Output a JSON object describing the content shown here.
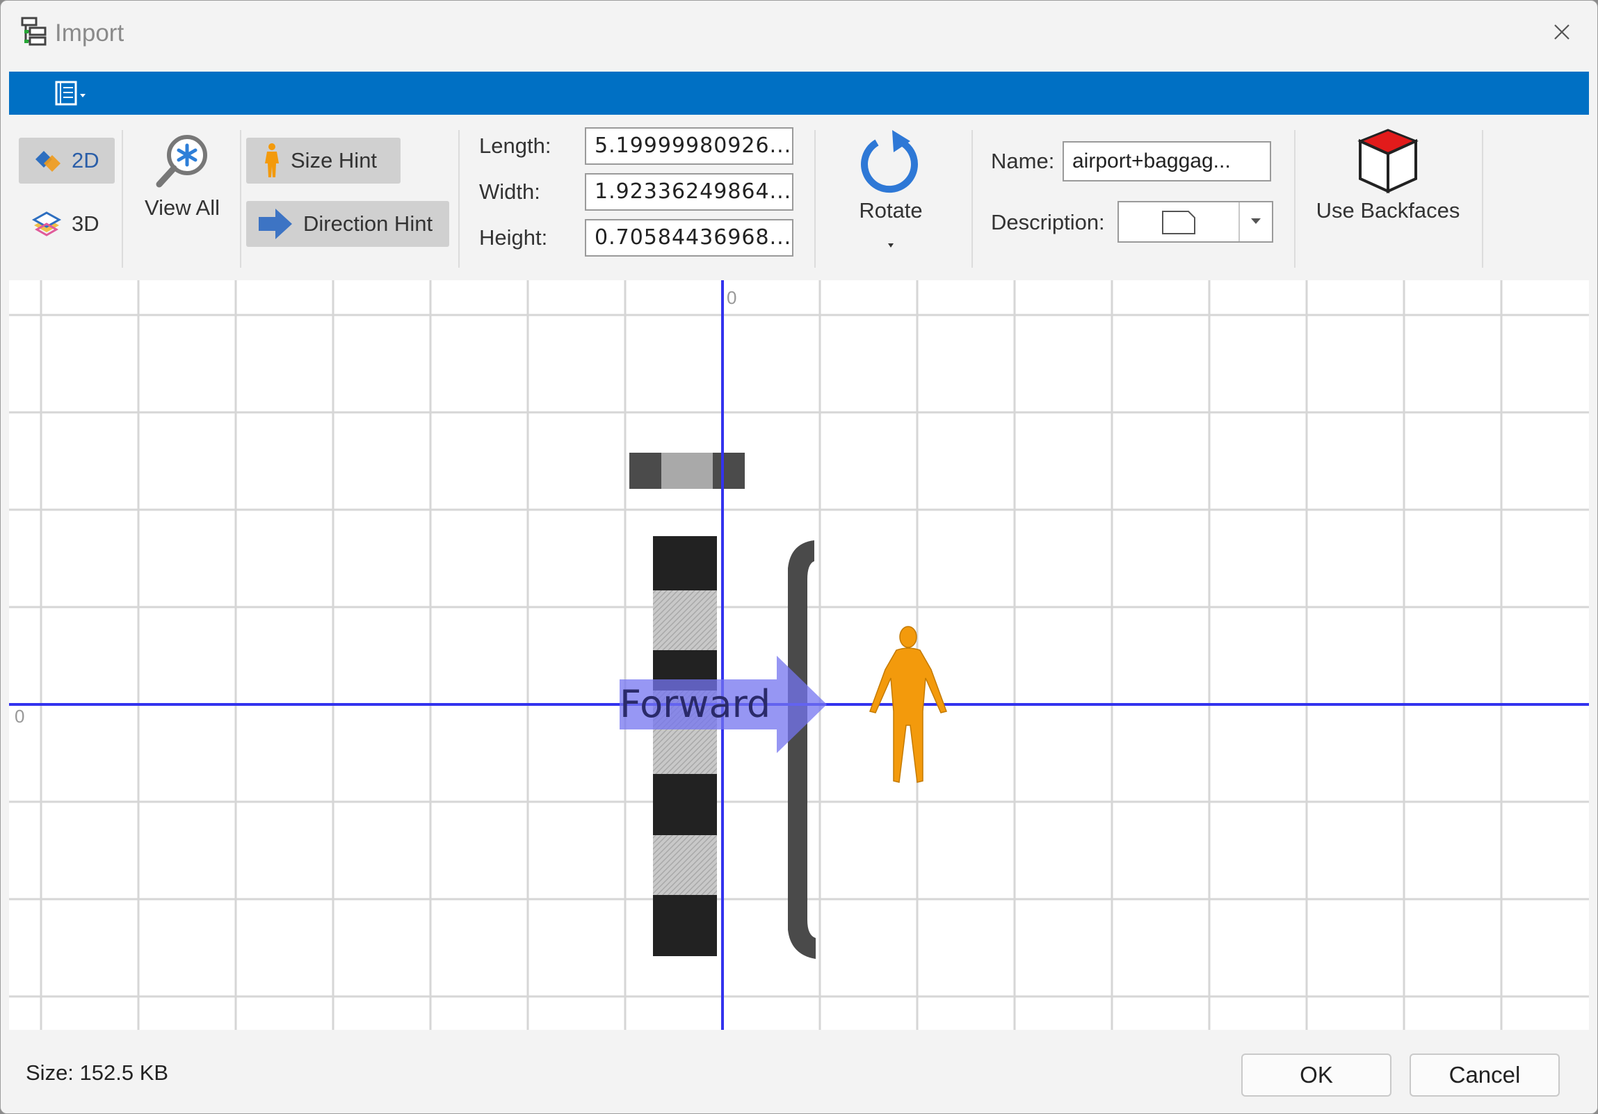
{
  "window": {
    "title": "Import"
  },
  "ribbon": {
    "view_mode": {
      "btn_2d": "2D",
      "btn_3d": "3D",
      "active": "2D"
    },
    "view_all": "View All",
    "hints": {
      "size_hint": "Size Hint",
      "direction_hint": "Direction Hint"
    },
    "dimensions": {
      "length_label": "Length:",
      "length_value": "5.19999980926...",
      "width_label": "Width:",
      "width_value": "1.92336249864...",
      "height_label": "Height:",
      "height_value": "0.70584436968..."
    },
    "rotate": "Rotate",
    "name_label": "Name:",
    "name_value": "airport+baggag...",
    "description_label": "Description:",
    "use_backfaces": "Use Backfaces"
  },
  "canvas": {
    "origin_x_label": "0",
    "origin_y_label": "0",
    "direction_label": "Forward"
  },
  "status": {
    "size": "Size: 152.5 KB"
  },
  "buttons": {
    "ok": "OK",
    "cancel": "Cancel"
  },
  "colors": {
    "accent": "#0070c4",
    "axis": "#3333ee",
    "direction_arrow": "#7a7aee",
    "size_figure": "#f39a0c",
    "object_dark": "#222222",
    "object_hatch": "#bdbdbd"
  },
  "icons": {
    "app": "import-tree-icon",
    "close": "close-icon",
    "qat": "ribbon-menu-icon",
    "view_2d": "2d-shape-icon",
    "view_3d": "3d-layers-icon",
    "view_all": "magnifier-icon",
    "size_hint": "person-icon",
    "direction_hint": "arrow-right-icon",
    "rotate": "rotate-icon",
    "description": "document-icon",
    "backfaces": "cube-icon"
  }
}
